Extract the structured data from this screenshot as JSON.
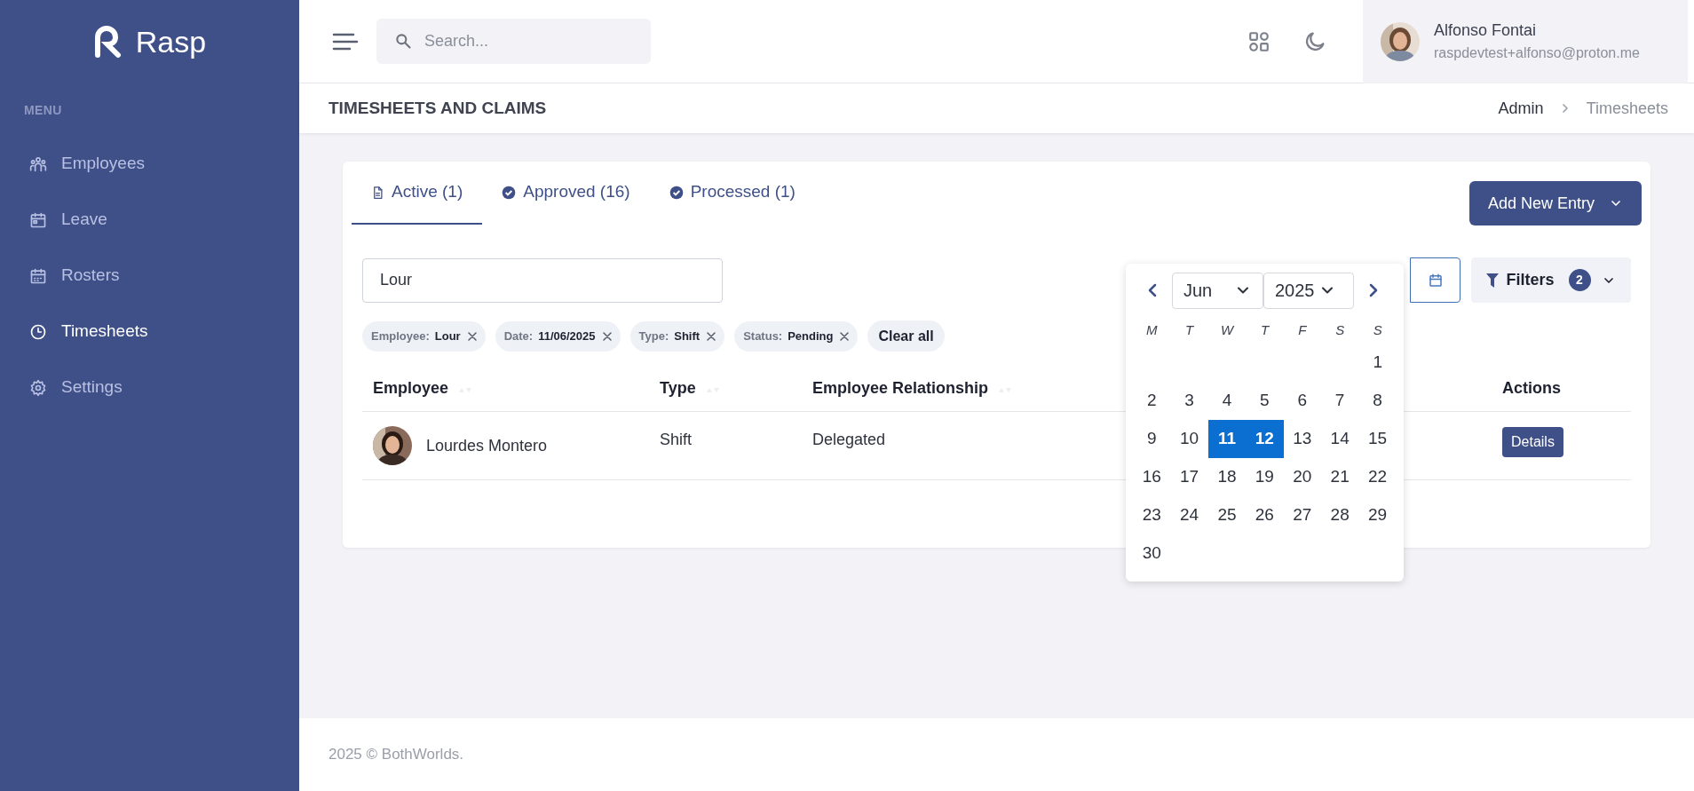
{
  "sidebar": {
    "logo": "Rasp",
    "section": "MENU",
    "items": [
      {
        "label": "Employees",
        "selected": false
      },
      {
        "label": "Leave",
        "selected": false
      },
      {
        "label": "Rosters",
        "selected": false
      },
      {
        "label": "Timesheets",
        "selected": true
      },
      {
        "label": "Settings",
        "selected": false
      }
    ]
  },
  "topbar": {
    "search": {
      "placeholder": "Search..."
    },
    "user": {
      "name": "Alfonso Fontai",
      "email": "raspdevtest+alfonso@proton.me"
    }
  },
  "page": {
    "title": "TIMESHEETS AND CLAIMS",
    "breadcrumb": [
      {
        "label": "Admin",
        "current": false
      },
      {
        "label": "Timesheets",
        "current": true
      }
    ]
  },
  "tabs": [
    {
      "label": "Active (1)",
      "selected": true
    },
    {
      "label": "Approved (16)",
      "selected": false
    },
    {
      "label": "Processed (1)",
      "selected": false
    }
  ],
  "add_button": "Add New Entry",
  "employee_search": {
    "value": "Lour"
  },
  "filters_button": {
    "label": "Filters",
    "count": "2"
  },
  "chips": [
    {
      "key": "Employee:",
      "value": "Lour"
    },
    {
      "key": "Date:",
      "value": "11/06/2025"
    },
    {
      "key": "Type:",
      "value": "Shift"
    },
    {
      "key": "Status:",
      "value": "Pending"
    }
  ],
  "clear_all": "Clear all",
  "table": {
    "columns": [
      {
        "label": "Employee",
        "sortable": true
      },
      {
        "label": "Type",
        "sortable": true
      },
      {
        "label": "Employee Relationship",
        "sortable": true
      },
      {
        "label": "Actions",
        "sortable": false
      }
    ],
    "rows": [
      {
        "employee": "Lourdes Montero",
        "type": "Shift",
        "relationship": "Delegated",
        "action": "Details"
      }
    ]
  },
  "calendar": {
    "month": "Jun",
    "year": "2025",
    "weekdays": [
      "M",
      "T",
      "W",
      "T",
      "F",
      "S",
      "S"
    ],
    "weeks": [
      [
        {
          "label": "1",
          "selected": false
        }
      ],
      [
        {
          "label": "2",
          "selected": false
        },
        {
          "label": "3",
          "selected": false
        },
        {
          "label": "4",
          "selected": false
        },
        {
          "label": "5",
          "selected": false
        },
        {
          "label": "6",
          "selected": false
        },
        {
          "label": "7",
          "selected": false
        },
        {
          "label": "8",
          "selected": false
        }
      ],
      [
        {
          "label": "9",
          "selected": false
        },
        {
          "label": "10",
          "selected": false
        },
        {
          "label": "11",
          "selected": true
        },
        {
          "label": "12",
          "selected": true
        },
        {
          "label": "13",
          "selected": false
        },
        {
          "label": "14",
          "selected": false
        },
        {
          "label": "15",
          "selected": false
        }
      ],
      [
        {
          "label": "16",
          "selected": false
        },
        {
          "label": "17",
          "selected": false
        },
        {
          "label": "18",
          "selected": false
        },
        {
          "label": "19",
          "selected": false
        },
        {
          "label": "20",
          "selected": false
        },
        {
          "label": "21",
          "selected": false
        },
        {
          "label": "22",
          "selected": false
        }
      ],
      [
        {
          "label": "23",
          "selected": false
        },
        {
          "label": "24",
          "selected": false
        },
        {
          "label": "25",
          "selected": false
        },
        {
          "label": "26",
          "selected": false
        },
        {
          "label": "27",
          "selected": false
        },
        {
          "label": "28",
          "selected": false
        },
        {
          "label": "29",
          "selected": false
        }
      ],
      [
        {
          "label": "30",
          "selected": false
        }
      ]
    ]
  },
  "footer": "2025 © BothWorlds."
}
